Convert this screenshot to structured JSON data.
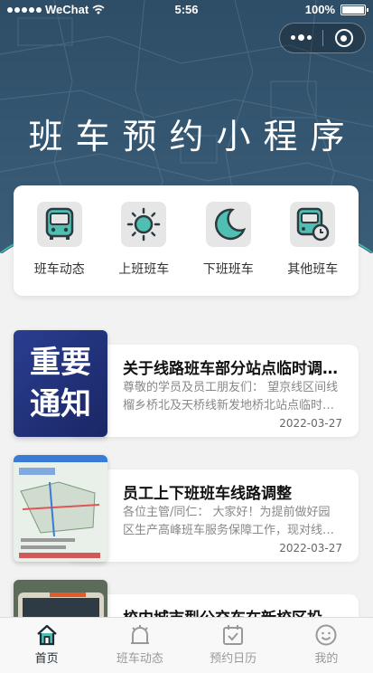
{
  "status_bar": {
    "carrier": "WeChat",
    "time": "5:56",
    "battery": "100%"
  },
  "header": {
    "title": "班车预约小程序"
  },
  "quick_menu": [
    {
      "label": "班车动态",
      "icon": "bus-icon"
    },
    {
      "label": "上班班车",
      "icon": "sun-icon"
    },
    {
      "label": "下班班车",
      "icon": "moon-icon"
    },
    {
      "label": "其他班车",
      "icon": "bus-clock-icon"
    }
  ],
  "news": [
    {
      "thumb_text": [
        "重要",
        "通知"
      ],
      "title": "关于线路班车部分站点临时调整的通知",
      "desc": "尊敬的学员及员工朋友们： 望京线区间线榴乡桥北及天桥线新发地桥北站点临时调整",
      "date": "2022-03-27"
    },
    {
      "title": "员工上下班班车线路调整",
      "desc": "各位主管/同仁： 大家好！为提前做好园区生产高峰班车服务保障工作，现对线路进行调整",
      "date": "2022-03-27"
    },
    {
      "title": "校内城市型公交车在新校区投入运行"
    }
  ],
  "tabs": [
    {
      "label": "首页",
      "icon": "home-icon",
      "active": true
    },
    {
      "label": "班车动态",
      "icon": "bus-dynamic-icon",
      "active": false
    },
    {
      "label": "预约日历",
      "icon": "calendar-icon",
      "active": false
    },
    {
      "label": "我的",
      "icon": "profile-icon",
      "active": false
    }
  ],
  "colors": {
    "header": "#34556f",
    "accent": "#3cc0b0",
    "icon_teal": "#4fbfb2",
    "notice_blue": "#2a3d8f"
  }
}
